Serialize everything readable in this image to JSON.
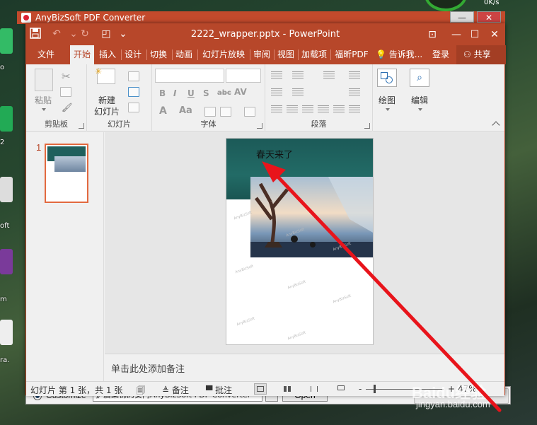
{
  "background_app": {
    "title": "AnyBizSoft PDF Converter",
    "radio_label": "Customize",
    "path_value": "护盾集锦的安门AnyBizSoft PDF Converter",
    "browse_label": "...",
    "open_label": "Open",
    "net_speed": "0K/s",
    "desktop_labels": [
      "o",
      "2",
      "oft",
      "m",
      "ra."
    ]
  },
  "window": {
    "title": "2222_wrapper.pptx - PowerPoint",
    "controls": {
      "ribbon_options": "⊡",
      "minimize": "—",
      "maximize": "☐",
      "close": "✕"
    },
    "quick_access": {
      "save": "💾",
      "undo": "↶",
      "redo": "↻",
      "present": "◰",
      "customize": "⌄"
    }
  },
  "menu": {
    "tabs": [
      "文件",
      "开始",
      "插入",
      "设计",
      "切换",
      "动画",
      "幻灯片放映",
      "审阅",
      "视图",
      "加载项",
      "福昕PDF"
    ],
    "active_tab": "开始",
    "tell_me": "告诉我...",
    "login": "登录",
    "share": "共享"
  },
  "ribbon": {
    "clipboard": {
      "label": "剪贴板",
      "paste": "粘贴"
    },
    "slides": {
      "label": "幻灯片",
      "new_slide_line1": "新建",
      "new_slide_line2": "幻灯片"
    },
    "font": {
      "label": "字体",
      "bold": "B",
      "italic": "I",
      "underline": "U",
      "strike": "S",
      "abc": "abc",
      "spacing": "AV",
      "font_color": "A",
      "case": "Aa"
    },
    "paragraph": {
      "label": "段落"
    },
    "drawing": {
      "label": "绘图"
    },
    "editing": {
      "label": "编辑"
    }
  },
  "slide_panel": {
    "slide_number": "1"
  },
  "slide": {
    "title": "春天来了"
  },
  "notes": {
    "placeholder": "单击此处添加备注"
  },
  "statusbar": {
    "slide_count": "幻灯片 第 1 张，共 1 张",
    "notes_label": "备注",
    "comments_label": "批注",
    "zoom": "47%",
    "zoom_minus": "-",
    "zoom_plus": "+"
  },
  "watermark": {
    "brand": "Baidu经验",
    "url": "jingyan.baidu.com"
  },
  "colors": {
    "accent": "#b7472a",
    "annotation_arrow": "#e8141b",
    "slide_teal": "#1f5f5c"
  }
}
